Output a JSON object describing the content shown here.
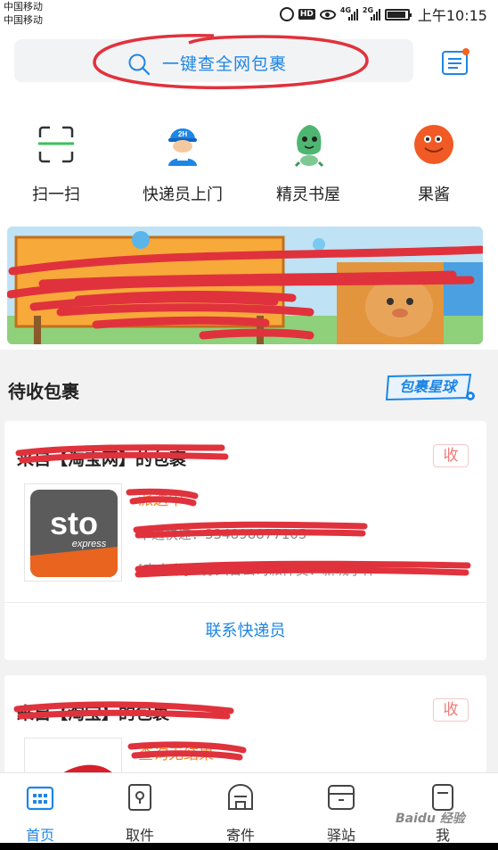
{
  "status_bar": {
    "carrier_1": "中国移动",
    "carrier_2": "中国移动",
    "hd_label": "HD",
    "network_1": "4G",
    "network_2": "2G",
    "time": "上午10:15"
  },
  "search": {
    "placeholder": "一键查全网包裹"
  },
  "quick_actions": [
    {
      "label": "扫一扫",
      "icon": "scan-icon"
    },
    {
      "label": "快递员上门",
      "icon": "courier-icon"
    },
    {
      "label": "精灵书屋",
      "icon": "elf-bookhouse-icon"
    },
    {
      "label": "果酱",
      "icon": "jam-icon"
    }
  ],
  "courier_badge": "2H",
  "section": {
    "title": "待收包裹",
    "brand_badge": "包裹星球"
  },
  "packages": [
    {
      "title": "来自【淘宝网】的包裹",
      "receive_label": "收",
      "status": "派送中",
      "tracking_line": "申通快递：334898877105",
      "location_line": "[南京市]江苏六合公司派件员：新城小件",
      "logo_text": "sto",
      "logo_sub": "express",
      "contact_label": "联系快递员"
    },
    {
      "title": "来自【淘宝】的包裹",
      "receive_label": "收",
      "status": "查询无结果"
    }
  ],
  "tabs": [
    {
      "label": "首页",
      "icon": "home-icon",
      "active": true
    },
    {
      "label": "取件",
      "icon": "pickup-icon",
      "active": false
    },
    {
      "label": "寄件",
      "icon": "send-icon",
      "active": false
    },
    {
      "label": "驿站",
      "icon": "station-icon",
      "active": false
    },
    {
      "label": "我",
      "icon": "profile-icon",
      "active": false
    }
  ],
  "watermark": "Baidu 经验",
  "colors": {
    "accent": "#1e86e4",
    "status_orange": "#f08a2a",
    "annotation_red": "#e0323c",
    "receive_badge": "#f07a7a"
  }
}
